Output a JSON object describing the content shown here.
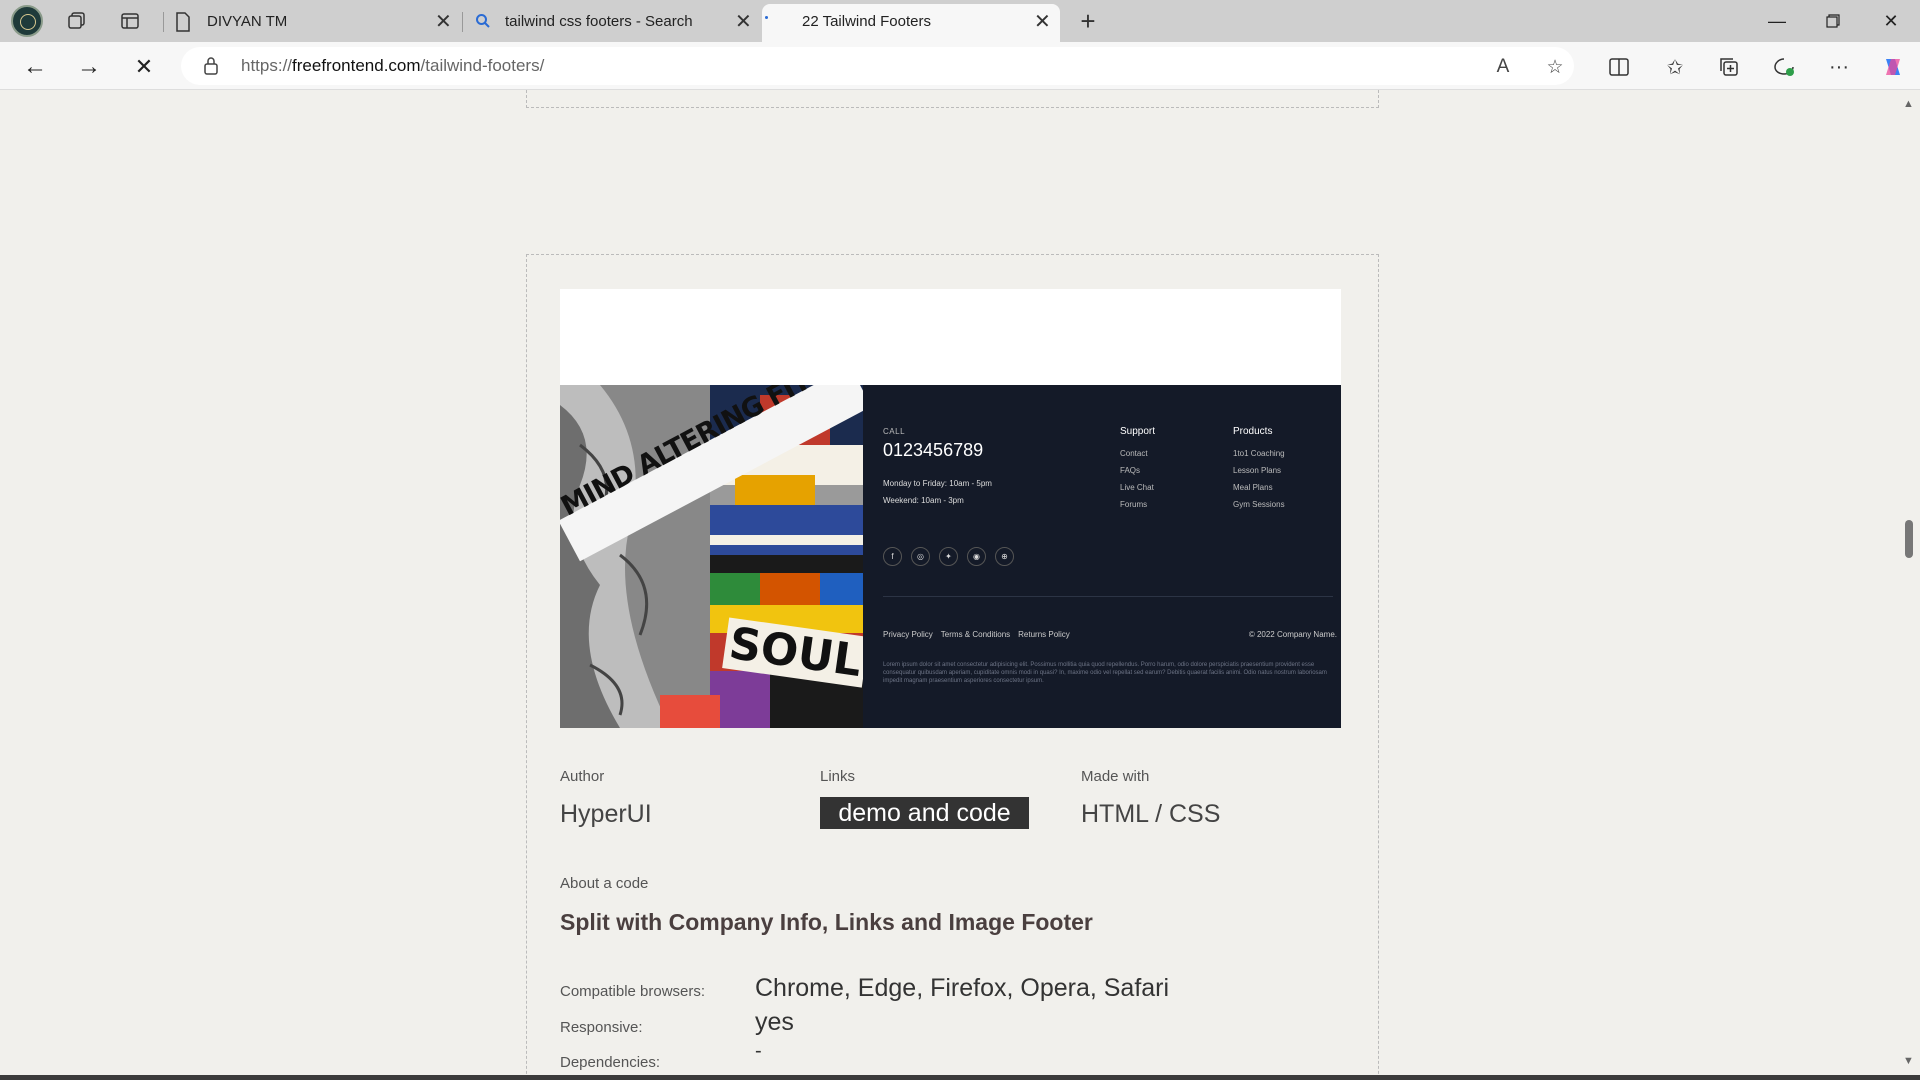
{
  "browser": {
    "tabs": [
      {
        "label": "DIVYAN TM"
      },
      {
        "label": "tailwind css footers - Search"
      },
      {
        "label": "22 Tailwind Footers"
      }
    ],
    "url_prefix": "https://",
    "url_domain": "freefrontend.com",
    "url_path": "/tailwind-footers/"
  },
  "footer_demo": {
    "image_text": "MIND ALTERING FITNESS",
    "image_text2": "SOUL",
    "call_label": "CALL",
    "phone": "0123456789",
    "hours_weekday": "Monday to Friday: 10am - 5pm",
    "hours_weekend": "Weekend: 10am - 3pm",
    "support": {
      "heading": "Support",
      "links": [
        "Contact",
        "FAQs",
        "Live Chat",
        "Forums"
      ]
    },
    "products": {
      "heading": "Products",
      "links": [
        "1to1 Coaching",
        "Lesson Plans",
        "Meal Plans",
        "Gym Sessions"
      ]
    },
    "legal_links": [
      "Privacy Policy",
      "Terms & Conditions",
      "Returns Policy"
    ],
    "copyright": "© 2022 Company Name.",
    "lorem": "Lorem ipsum dolor sit amet consectetur adipisicing elit. Possimus mollitia quia quod repellendus. Porro harum, odio dolore perspiciatis praesentium provident esse consequatur quibusdam aperiam, cupiditate omnis modi in quasi? In, maxime odio vel repellat sed earum? Debitis quaerat facilis animi. Odio natus nostrum laboriosam impedit magnam praesentium asperiores consectetur ipsum."
  },
  "meta": {
    "author_label": "Author",
    "author_value": "HyperUI",
    "links_label": "Links",
    "links_value": "demo and code",
    "made_label": "Made with",
    "made_value": "HTML / CSS"
  },
  "about": {
    "label": "About a code",
    "title": "Split with Company Info, Links and Image Footer"
  },
  "specs": [
    {
      "label": "Compatible browsers:",
      "value": "Chrome, Edge, Firefox, Opera, Safari"
    },
    {
      "label": "Responsive:",
      "value": "yes"
    },
    {
      "label": "Dependencies:",
      "value": "-"
    }
  ]
}
